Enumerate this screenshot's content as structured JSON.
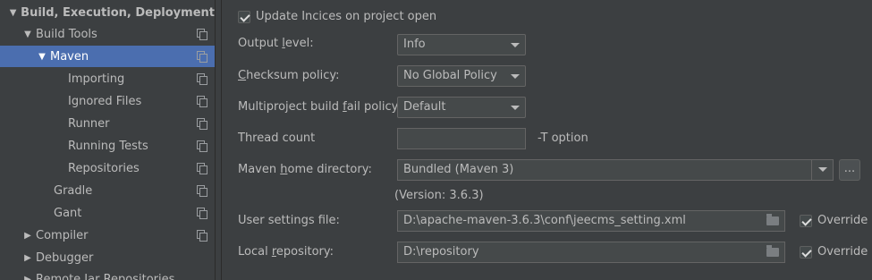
{
  "sidebar": {
    "items": [
      {
        "label": "Build, Execution, Deployment",
        "arrow": "▼"
      },
      {
        "label": "Build Tools",
        "arrow": "▼"
      },
      {
        "label": "Maven",
        "arrow": "▼"
      },
      {
        "label": "Importing"
      },
      {
        "label": "Ignored Files"
      },
      {
        "label": "Runner"
      },
      {
        "label": "Running Tests"
      },
      {
        "label": "Repositories"
      },
      {
        "label": "Gradle"
      },
      {
        "label": "Gant"
      },
      {
        "label": "Compiler",
        "arrow": "▶"
      },
      {
        "label": "Debugger",
        "arrow": "▶"
      },
      {
        "label": "Remote Jar Repositories",
        "arrow": "▶"
      }
    ]
  },
  "settings": {
    "update_indices_label": "Update Incices on project open",
    "output_level": {
      "label_pre": "Output ",
      "label_u": "l",
      "label_post": "evel:",
      "value": "Info"
    },
    "checksum_policy": {
      "label_pre": "",
      "label_u": "C",
      "label_post": "hecksum policy:",
      "value": "No Global Policy"
    },
    "fail_policy": {
      "label_pre": "Multiproject build ",
      "label_u": "f",
      "label_post": "ail policy:",
      "value": "Default"
    },
    "thread_count": {
      "label": "Thread count",
      "value": "",
      "suffix": "-T option"
    },
    "maven_home": {
      "label_pre": "Maven ",
      "label_u": "h",
      "label_post": "ome directory:",
      "value": "Bundled (Maven 3)",
      "browse": "...",
      "version": "(Version: 3.6.3)"
    },
    "user_settings": {
      "label": "User settings file:",
      "value": "D:\\apache-maven-3.6.3\\conf\\jeecms_setting.xml",
      "override": "Override"
    },
    "local_repo": {
      "label_pre": "Local ",
      "label_u": "r",
      "label_post": "epository:",
      "value": "D:\\repository",
      "override": "Override"
    }
  }
}
